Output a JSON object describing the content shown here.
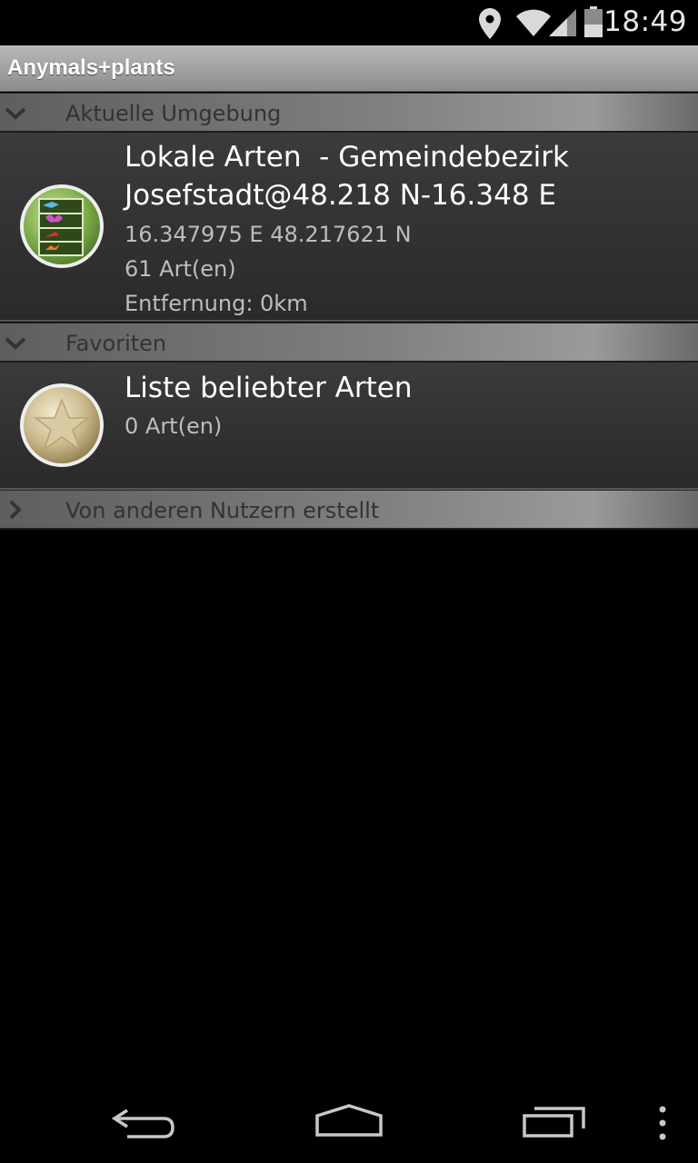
{
  "status_bar": {
    "time": "18:49",
    "icons": [
      "location-icon",
      "wifi-icon",
      "signal-icon",
      "battery-icon"
    ]
  },
  "app": {
    "title": "Anymals+plants"
  },
  "groups": [
    {
      "label": "Aktuelle Umgebung",
      "expanded": true,
      "items": [
        {
          "icon": "species-list-icon",
          "title_line1": "Lokale Arten  - Gemeindebezirk",
          "title_line2": "Josefstadt@48.218 N-16.348 E",
          "coords": "16.347975 E 48.217621 N",
          "count": "61 Art(en)",
          "distance": "Entfernung: 0km"
        }
      ]
    },
    {
      "label": "Favoriten",
      "expanded": true,
      "items": [
        {
          "icon": "star-icon",
          "title_line1": "Liste beliebter Arten",
          "count": "0 Art(en)"
        }
      ]
    },
    {
      "label": "Von anderen Nutzern erstellt",
      "expanded": false
    }
  ],
  "nav_bar": {
    "buttons": [
      "back-icon",
      "home-icon",
      "recents-icon",
      "overflow-menu-icon"
    ]
  },
  "colors": {
    "background": "#000000",
    "title_bar": "#a3a3a3",
    "list_item": "#333333",
    "group_header": "#808080"
  }
}
